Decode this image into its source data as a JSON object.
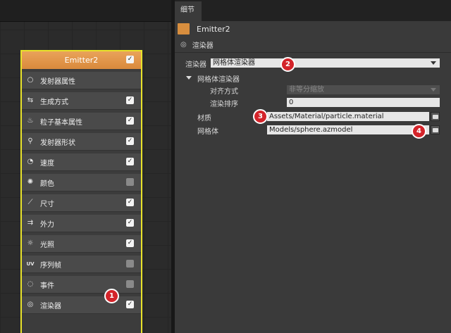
{
  "graph": {
    "node": {
      "title": "Emitter2",
      "modules": [
        {
          "label": "发射器属性",
          "icon": "circle-icon",
          "glyph": "○",
          "checked": null
        },
        {
          "label": "生成方式",
          "icon": "spawn-arrows-icon",
          "glyph": "⇆",
          "checked": true
        },
        {
          "label": "粒子基本属性",
          "icon": "flame-icon",
          "glyph": "♨",
          "checked": true
        },
        {
          "label": "发射器形状",
          "icon": "location-pin-icon",
          "glyph": "⚲",
          "checked": true
        },
        {
          "label": "速度",
          "icon": "speedometer-icon",
          "glyph": "◔",
          "checked": true
        },
        {
          "label": "颜色",
          "icon": "palette-icon",
          "glyph": "✺",
          "checked": false
        },
        {
          "label": "尺寸",
          "icon": "ruler-icon",
          "glyph": "⟋",
          "checked": true
        },
        {
          "label": "外力",
          "icon": "force-arrows-icon",
          "glyph": "⇉",
          "checked": true
        },
        {
          "label": "光照",
          "icon": "sun-icon",
          "glyph": "☼",
          "checked": true
        },
        {
          "label": "序列帧",
          "icon": "uv-icon",
          "glyph": "UV",
          "checked": false
        },
        {
          "label": "事件",
          "icon": "event-dots-icon",
          "glyph": "◌",
          "checked": false
        },
        {
          "label": "渲染器",
          "icon": "renderer-icon",
          "glyph": "◎",
          "checked": true
        }
      ]
    }
  },
  "panel": {
    "tab_label": "细节",
    "entity_name": "Emitter2",
    "component_label": "渲染器",
    "renderer": {
      "label": "渲染器",
      "value": "网格体渲染器",
      "section_title": "网格体渲染器",
      "align_label": "对齐方式",
      "align_value": "非等分缩放",
      "sort_label": "渲染排序",
      "sort_value": "0",
      "material_label": "材质",
      "material_value": "Assets/Material/particle.material",
      "mesh_label": "网格体",
      "mesh_value": "Models/sphere.azmodel"
    }
  },
  "badges": [
    "1",
    "2",
    "3",
    "4"
  ],
  "colors": {
    "node_header": "#e09448",
    "selection_border": "#e8e22a",
    "badge": "#d4242a"
  }
}
